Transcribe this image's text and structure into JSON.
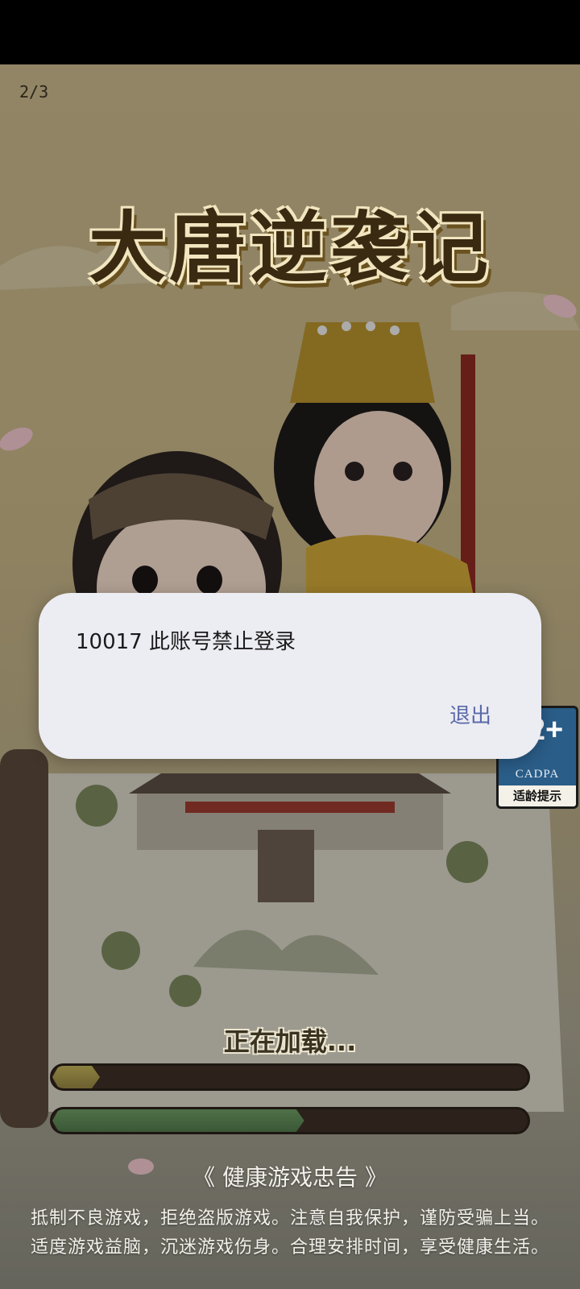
{
  "page_counter": "2/3",
  "game": {
    "title": "大唐逆袭记"
  },
  "age_badge": {
    "rating": "12+",
    "org": "CADPA",
    "tip": "适龄提示"
  },
  "loading": {
    "text": "正在加载...",
    "progress_primary": 0.1,
    "progress_secondary": 0.53
  },
  "health_notice": {
    "title": "《 健康游戏忠告 》",
    "line1": "抵制不良游戏，拒绝盗版游戏。注意自我保护，谨防受骗上当。",
    "line2": "适度游戏益脑，沉迷游戏伤身。合理安排时间，享受健康生活。"
  },
  "dialog": {
    "message": "10017 此账号禁止登录",
    "exit_label": "退出"
  },
  "colors": {
    "dialog_bg": "#ececf3",
    "exit_text": "#5a6aa8",
    "badge_blue": "#2a5d88"
  }
}
